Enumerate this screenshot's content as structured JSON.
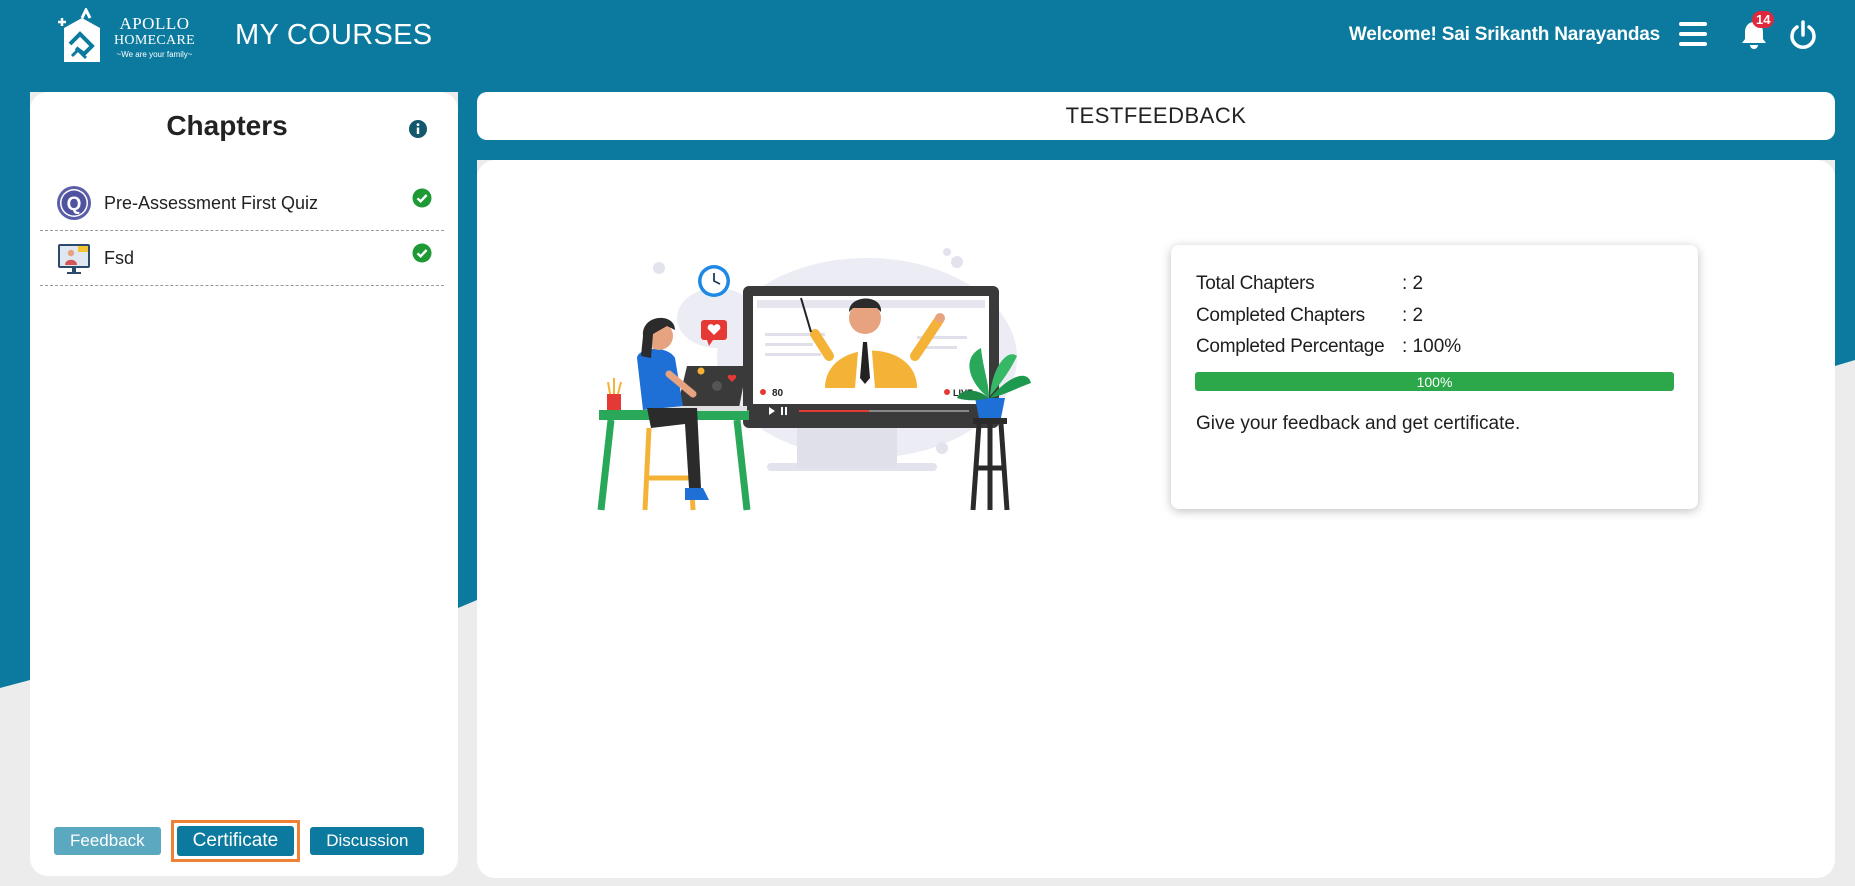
{
  "header": {
    "logo": {
      "line1": "APOLLO",
      "line2": "HOMECARE",
      "tagline": "~We are your family~"
    },
    "page_title": "MY COURSES",
    "welcome": "Welcome! Sai Srikanth Narayandas",
    "notification_count": "14"
  },
  "sidebar": {
    "title": "Chapters",
    "chapters": [
      {
        "label": "Pre-Assessment First Quiz",
        "icon": "quiz-icon",
        "completed": true
      },
      {
        "label": "Fsd",
        "icon": "video-lesson-icon",
        "completed": true
      }
    ],
    "buttons": {
      "feedback": "Feedback",
      "certificate": "Certificate",
      "discussion": "Discussion"
    }
  },
  "course": {
    "title": "TESTFEEDBACK"
  },
  "stats": {
    "total_chapters_label": "Total Chapters",
    "total_chapters_value": ": 2",
    "completed_chapters_label": "Completed Chapters",
    "completed_chapters_value": ": 2",
    "completed_percentage_label": "Completed Percentage",
    "completed_percentage_value": ": 100%",
    "progress_percent": 100,
    "progress_text": "100%",
    "message": "Give your feedback and get certificate."
  },
  "illustration_labels": {
    "viewers": "80",
    "live": "LIVE"
  },
  "colors": {
    "teal": "#0b7a9e",
    "button_light": "#5aa9c0",
    "highlight_orange": "#ef8136",
    "progress_green": "#2ca84a",
    "badge_red": "#e0283d",
    "check_green": "#1e9a35"
  }
}
